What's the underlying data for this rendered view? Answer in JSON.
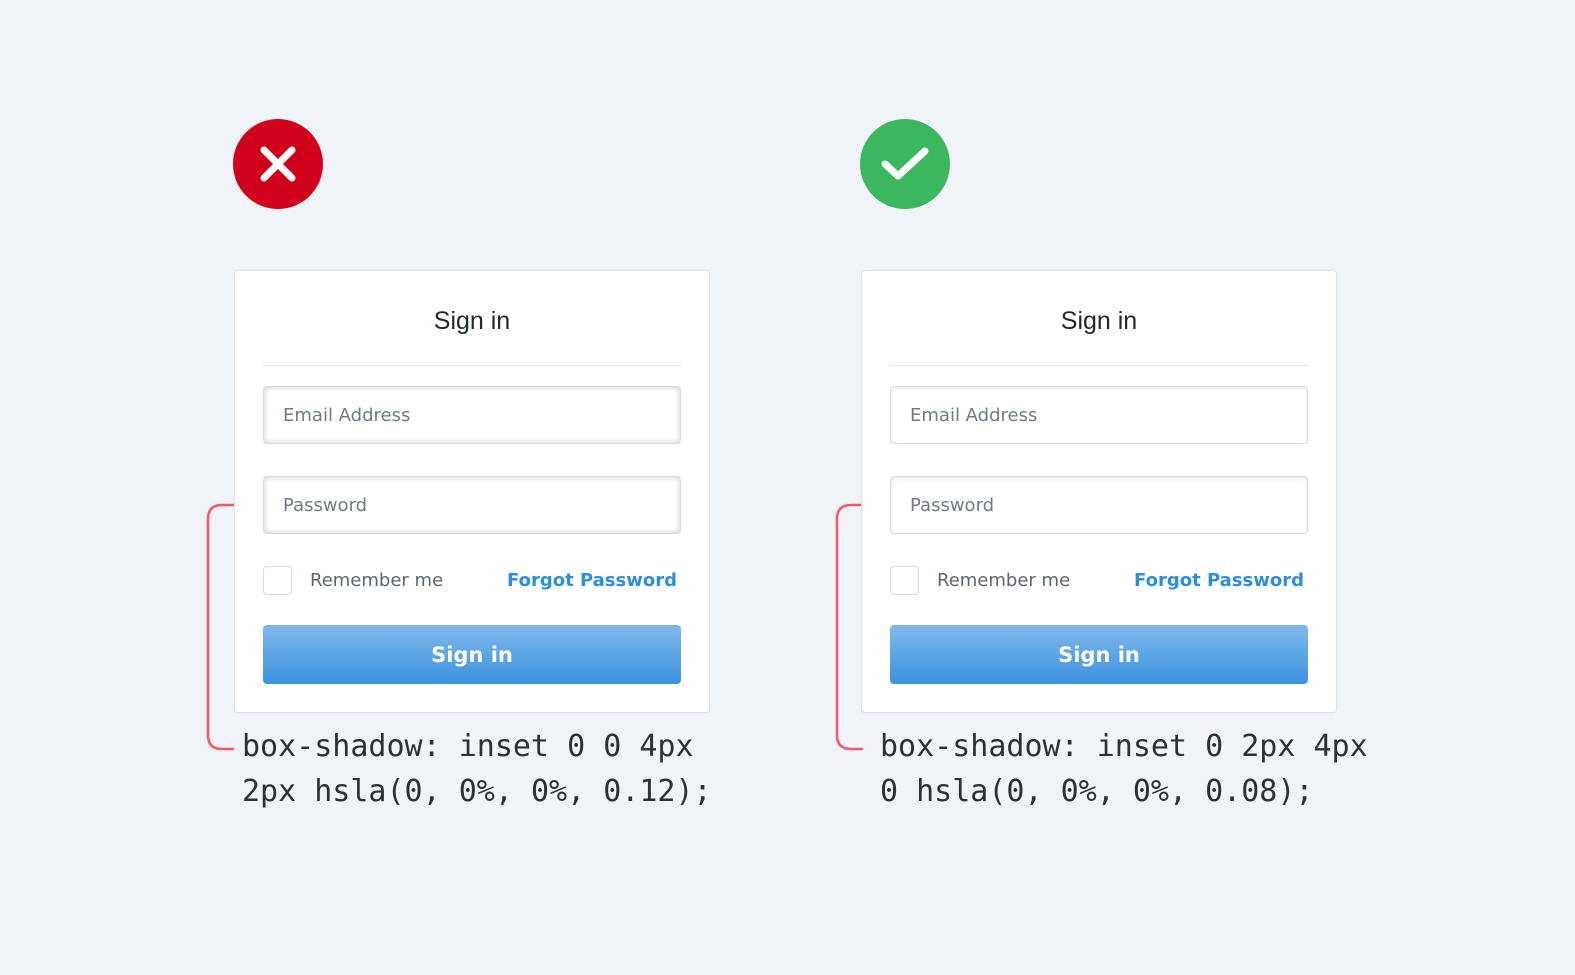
{
  "panels": [
    {
      "verdict": "bad",
      "verdict_icon": "x-icon",
      "verdict_color": "#d0021b",
      "title": "Sign in",
      "email_placeholder": "Email Address",
      "password_placeholder": "Password",
      "remember_label": "Remember me",
      "forgot_label": "Forgot Password",
      "submit_label": "Sign in",
      "code_line1": "box-shadow: inset 0 0 4px",
      "code_line2": "2px hsla(0, 0%, 0%, 0.12);"
    },
    {
      "verdict": "good",
      "verdict_icon": "check-icon",
      "verdict_color": "#3bb75e",
      "title": "Sign in",
      "email_placeholder": "Email Address",
      "password_placeholder": "Password",
      "remember_label": "Remember me",
      "forgot_label": "Forgot Password",
      "submit_label": "Sign in",
      "code_line1": "box-shadow: inset 0 2px 4px",
      "code_line2": "0 hsla(0, 0%, 0%, 0.08);"
    }
  ],
  "colors": {
    "accent": "#2d8ee0",
    "connector": "#f5566c",
    "background": "#f0f3f7"
  }
}
